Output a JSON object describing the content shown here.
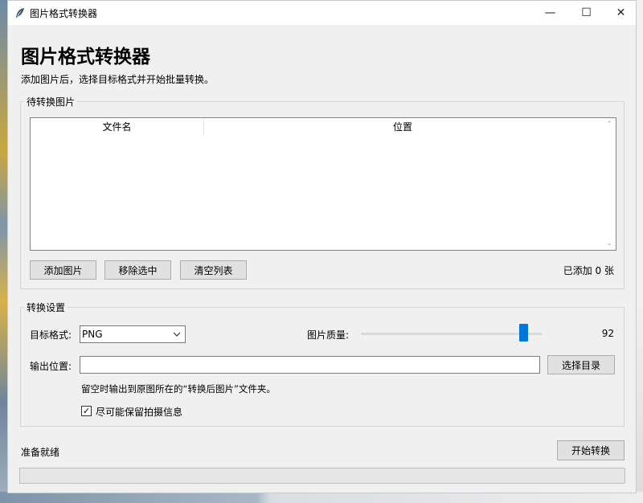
{
  "window": {
    "title": "图片格式转换器",
    "controls": {
      "minimize": "—",
      "maximize": "☐",
      "close": "✕"
    }
  },
  "header": {
    "title": "图片格式转换器",
    "description": "添加图片后，选择目标格式并开始批量转换。"
  },
  "files_group": {
    "title": "待转换图片",
    "columns": [
      "文件名",
      "位置"
    ],
    "rows": [],
    "buttons": {
      "add": "添加图片",
      "remove": "移除选中",
      "clear": "清空列表"
    },
    "count_text": "已添加 0 张"
  },
  "settings_group": {
    "title": "转换设置",
    "format_label": "目标格式:",
    "format_value": "PNG",
    "quality_label": "图片质量:",
    "quality_value": 92,
    "quality_max": 100,
    "output_label": "输出位置:",
    "output_value": "",
    "choose_dir_button": "选择目录",
    "hint": "留空时输出到原图所在的“转换后图片”文件夹。",
    "keep_exif_label": "尽可能保留拍摄信息",
    "keep_exif_checked": true
  },
  "footer": {
    "status": "准备就绪",
    "start_button": "开始转换",
    "progress": 0
  },
  "colors": {
    "accent": "#0078d7",
    "progress": "#06b025"
  },
  "icons": {
    "app": "feather-icon",
    "dropdown": "chevron-down-icon",
    "check": "check-icon"
  }
}
